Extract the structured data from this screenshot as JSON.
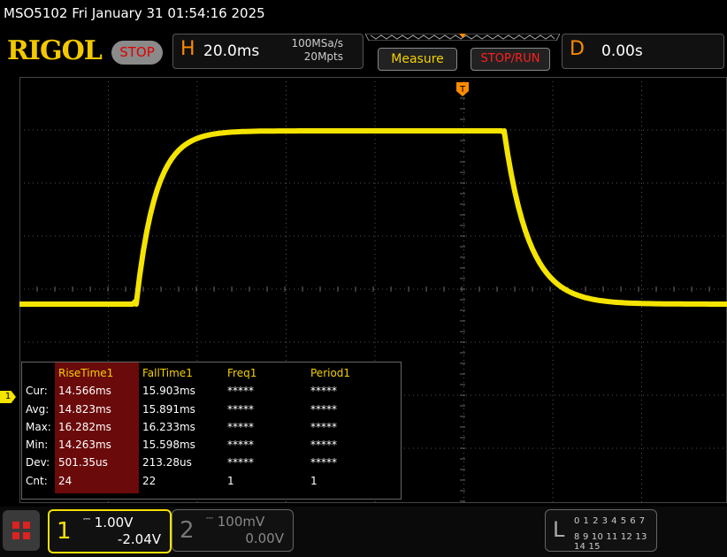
{
  "header": {
    "title": "MSO5102  Fri January 31 01:54:16 2025",
    "brand": "RIGOL",
    "stop_label": "STOP"
  },
  "horizontal": {
    "letter": "H",
    "timebase": "20.0ms",
    "sample_rate": "100MSa/s",
    "memory_depth": "20Mpts"
  },
  "buttons": {
    "measure": "Measure",
    "stop_run": "STOP/RUN"
  },
  "delay": {
    "letter": "D",
    "value": "0.00s"
  },
  "trigger_marker": "T",
  "channel_marker": "1",
  "measurements": {
    "row_labels": [
      "Cur:",
      "Avg:",
      "Max:",
      "Min:",
      "Dev:",
      "Cnt:"
    ],
    "columns": [
      {
        "header": "RiseTime1",
        "values": [
          "14.566ms",
          "14.823ms",
          "16.282ms",
          "14.263ms",
          "501.35us",
          "24"
        ]
      },
      {
        "header": "FallTime1",
        "values": [
          "15.903ms",
          "15.891ms",
          "16.233ms",
          "15.598ms",
          "213.28us",
          "22"
        ]
      },
      {
        "header": "Freq1",
        "values": [
          "*****",
          "*****",
          "*****",
          "*****",
          "*****",
          "1"
        ]
      },
      {
        "header": "Period1",
        "values": [
          "*****",
          "*****",
          "*****",
          "*****",
          "*****",
          "1"
        ]
      }
    ]
  },
  "channels": {
    "ch1": {
      "number": "1",
      "scale": "1.00V",
      "offset": "-2.04V",
      "color": "#f4e000"
    },
    "ch2": {
      "number": "2",
      "scale": "100mV",
      "offset": "0.00V",
      "color": "#777777"
    }
  },
  "logic": {
    "letter": "L",
    "row1": "0 1 2 3  4 5 6 7",
    "row2": "8 9 10 11 12 13 14 15"
  },
  "colors": {
    "trace": "#f4e400",
    "brand": "#f4c800",
    "accent_orange": "#ff8a00",
    "stop_red": "#e00000"
  }
}
